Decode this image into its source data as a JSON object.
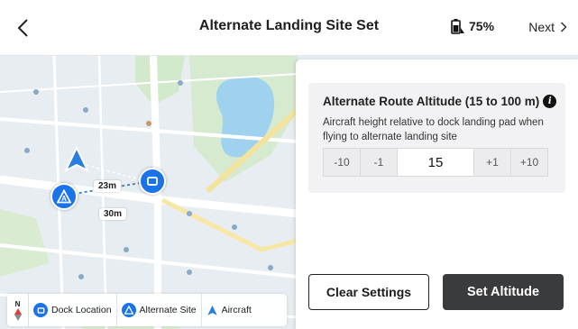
{
  "header": {
    "title": "Alternate Landing Site Set",
    "battery": "75%",
    "next_label": "Next"
  },
  "map": {
    "distance_1": "23m",
    "distance_2": "30m"
  },
  "legend": {
    "compass": "N",
    "dock": "Dock Location",
    "alternate": "Alternate Site",
    "aircraft": "Aircraft"
  },
  "panel": {
    "title": "Alternate Route Altitude (15 to 100 m)",
    "info_glyph": "i",
    "description": "Aircraft height relative to dock landing pad when flying to alternate landing site",
    "stepper": {
      "minus10": "-10",
      "minus1": "-1",
      "value": "15",
      "plus1": "+1",
      "plus10": "+10"
    },
    "clear_label": "Clear Settings",
    "set_label": "Set Altitude"
  },
  "colors": {
    "accent": "#1a73e8",
    "button_dark": "#3a3b3d",
    "map_road": "#ffffff",
    "map_park": "#cde8c4",
    "map_water": "#9ed1ee"
  },
  "icons": [
    "back-chevron-icon",
    "battery-icon",
    "next-chevron-icon",
    "info-icon",
    "dock-icon",
    "alternate-site-icon",
    "aircraft-icon",
    "compass-icon"
  ]
}
